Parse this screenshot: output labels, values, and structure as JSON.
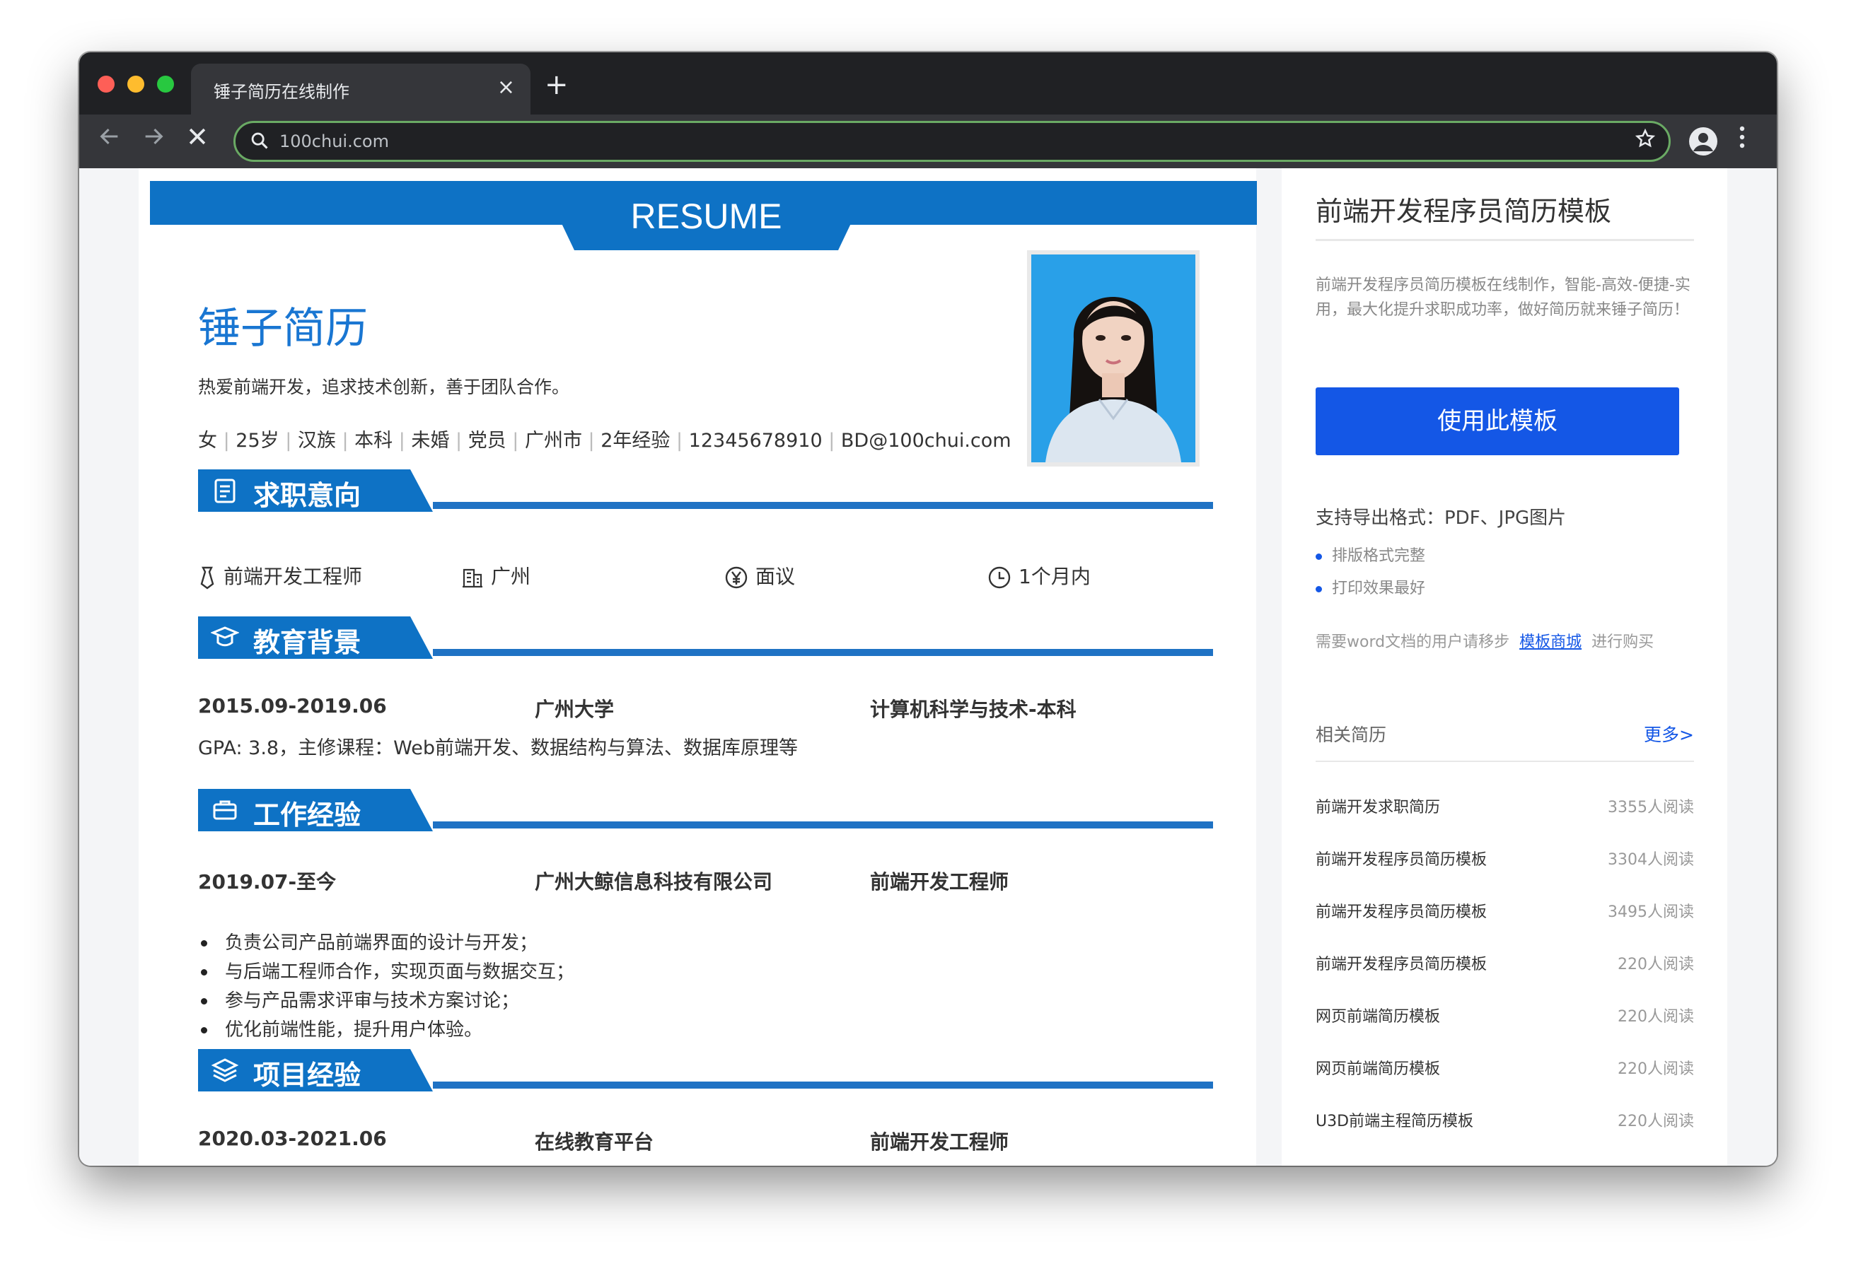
{
  "browser": {
    "tab_title": "锤子简历在线制作",
    "close_glyph": "×",
    "new_tab_glyph": "+",
    "url": "100chui.com"
  },
  "resume": {
    "header_label": "RESUME",
    "name": "锤子简历",
    "intro": "热爱前端开发，追求技术创新，善于团队合作。",
    "info_items": [
      "女",
      "25岁",
      "汉族",
      "本科",
      "未婚",
      "党员",
      "广州市",
      "2年经验",
      "12345678910",
      "BD@100chui.com"
    ],
    "sections": {
      "intent": "求职意向",
      "education": "教育背景",
      "work": "工作经验",
      "project": "项目经验"
    },
    "intent": {
      "position": "前端开发工程师",
      "city": "广州",
      "salary": "面议",
      "availability": "1个月内"
    },
    "education": {
      "period": "2015.09-2019.06",
      "school": "广州大学",
      "major": "计算机科学与技术-本科",
      "detail": "GPA: 3.8，主修课程：Web前端开发、数据结构与算法、数据库原理等"
    },
    "work": {
      "period": "2019.07-至今",
      "company": "广州大鲸信息科技有限公司",
      "role": "前端开发工程师",
      "bullets": [
        "负责公司产品前端界面的设计与开发；",
        "与后端工程师合作，实现页面与数据交互；",
        "参与产品需求评审与技术方案讨论；",
        "优化前端性能，提升用户体验。"
      ]
    },
    "project": {
      "period": "2020.03-2021.06",
      "name": "在线教育平台",
      "role": "前端开发工程师"
    }
  },
  "sidebar": {
    "title": "前端开发程序员简历模板",
    "description": "前端开发程序员简历模板在线制作，智能-高效-便捷-实用，最大化提升求职成功率，做好简历就来锤子简历！",
    "use_button": "使用此模板",
    "formats": "支持导出格式：PDF、JPG图片",
    "features": [
      "排版格式完整",
      "打印效果最好"
    ],
    "word_note_before": "需要word文档的用户请移步",
    "word_link": "模板商城",
    "word_note_after": "进行购买",
    "related_title": "相关简历",
    "more": "更多>",
    "related": [
      {
        "title": "前端开发求职简历",
        "count": "3355人阅读"
      },
      {
        "title": "前端开发程序员简历模板",
        "count": "3304人阅读"
      },
      {
        "title": "前端开发程序员简历模板",
        "count": "3495人阅读"
      },
      {
        "title": "前端开发程序员简历模板",
        "count": "220人阅读"
      },
      {
        "title": "网页前端简历模板",
        "count": "220人阅读"
      },
      {
        "title": "网页前端简历模板",
        "count": "220人阅读"
      },
      {
        "title": "U3D前端主程简历模板",
        "count": "220人阅读"
      }
    ]
  },
  "colors": {
    "resume_blue": "#0e72c5",
    "name_blue": "#1976d2",
    "button_blue": "#1457e6",
    "url_focus": "#6aaa64"
  }
}
